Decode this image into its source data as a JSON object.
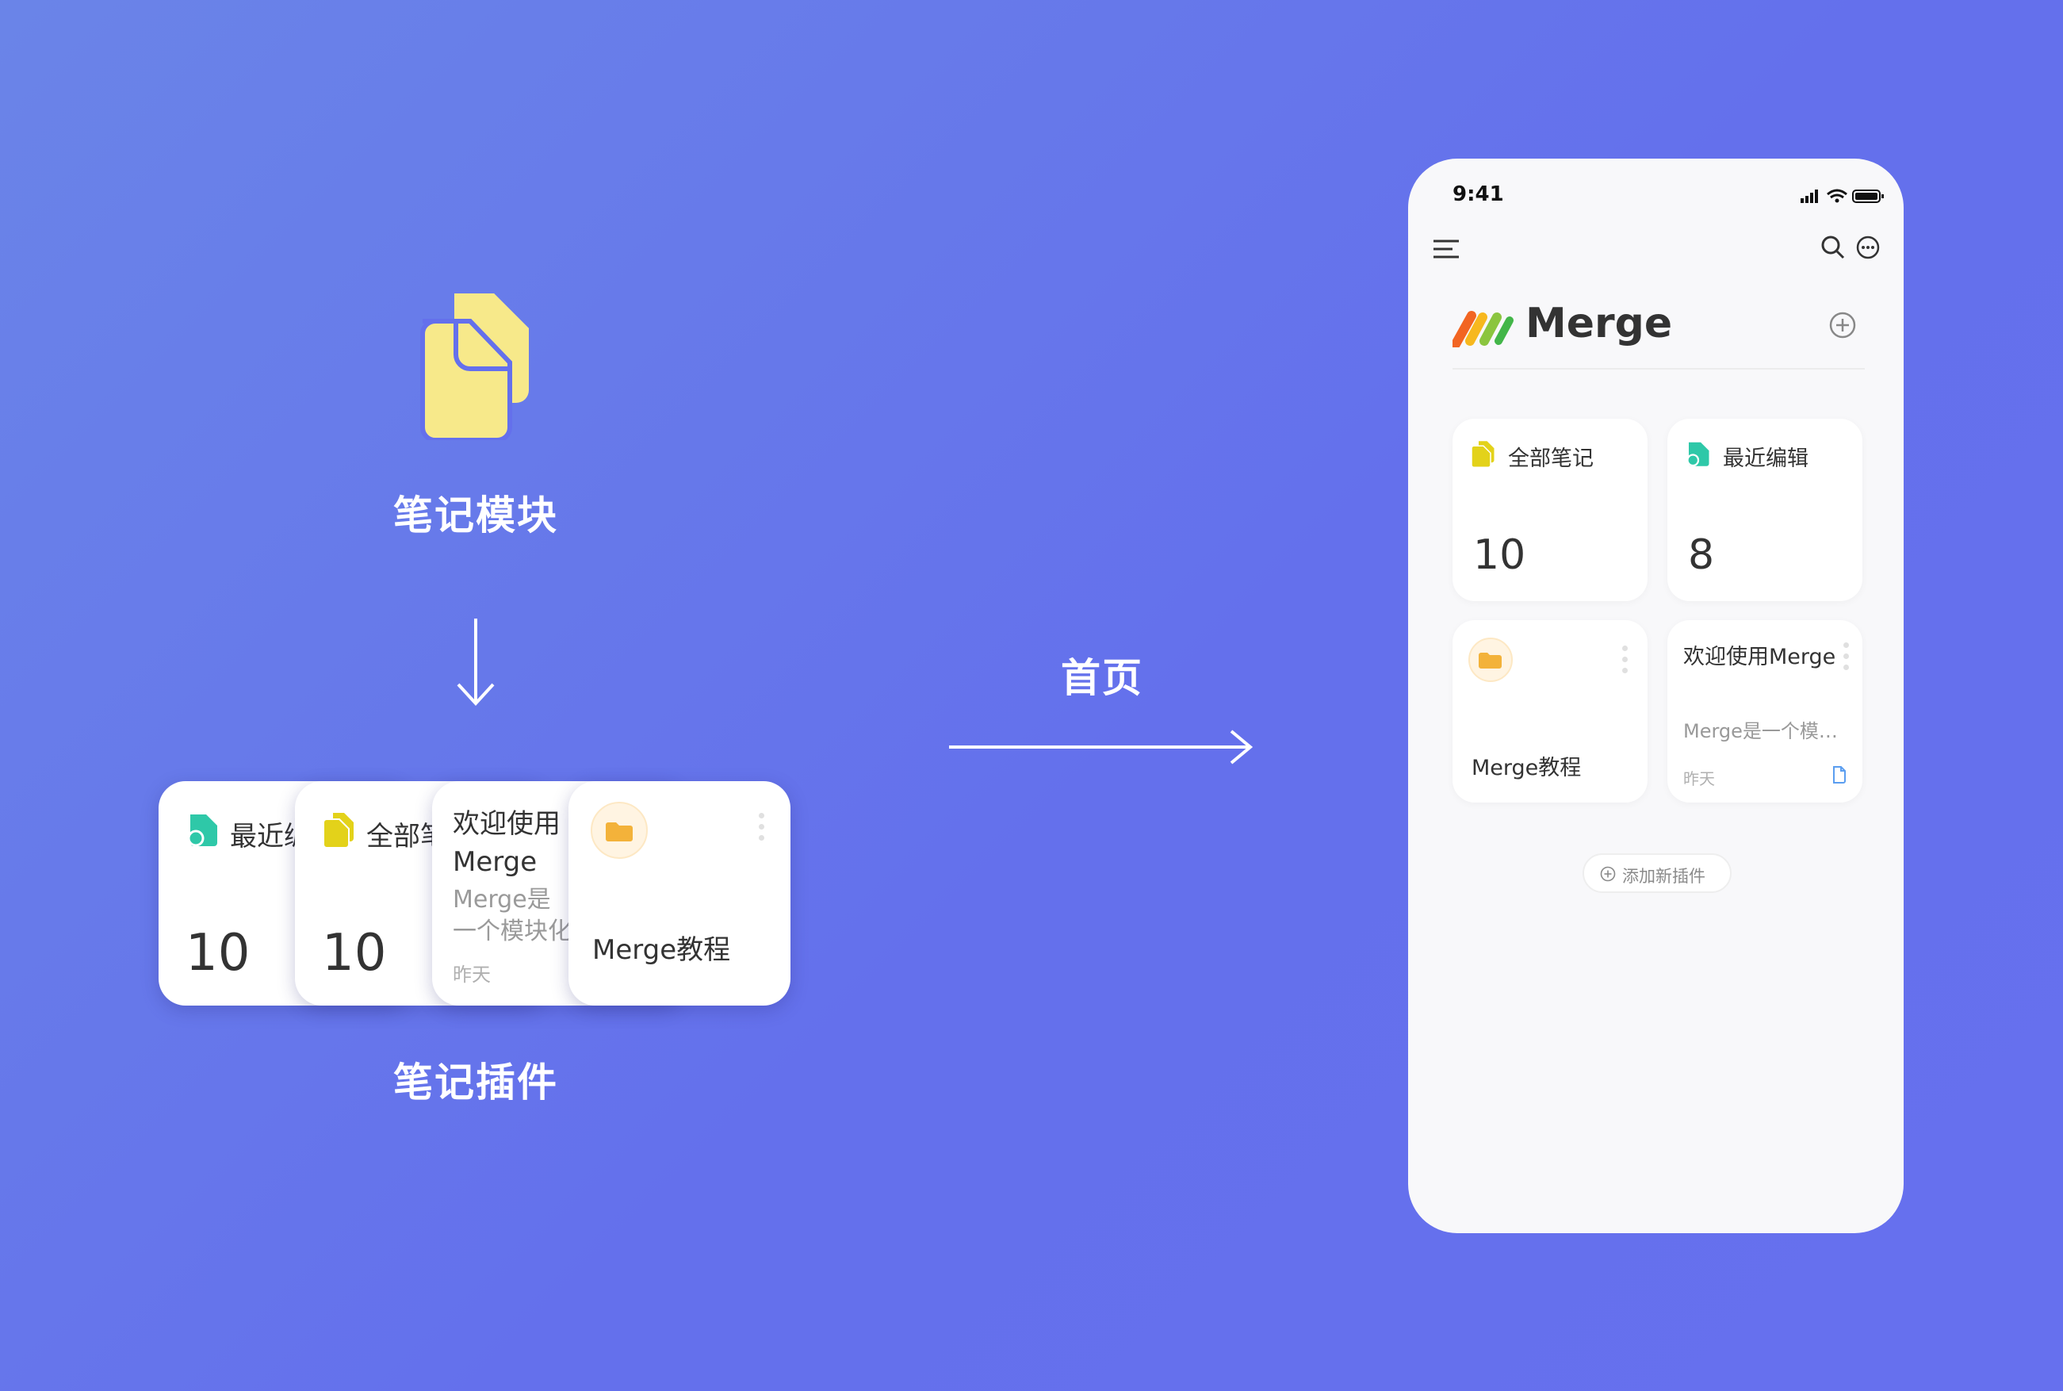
{
  "left": {
    "module_label": "笔记模块",
    "plugin_label": "笔记插件",
    "cards": {
      "recent": {
        "title": "最近编辑",
        "count": "10"
      },
      "all": {
        "title": "全部笔记",
        "count": "10"
      },
      "welcome": {
        "title": "欢迎使用Merge",
        "desc": "Merge是一个模块化效率工具",
        "date": "昨天"
      },
      "folder": {
        "name": "Merge教程"
      }
    }
  },
  "middle": {
    "home_label": "首页"
  },
  "phone": {
    "status_time": "9:41",
    "app_title": "Merge",
    "cards": {
      "all": {
        "title": "全部笔记",
        "count": "10"
      },
      "recent": {
        "title": "最近编辑",
        "count": "8"
      },
      "folder": {
        "name": "Merge教程"
      },
      "welcome": {
        "title": "欢迎使用Merge",
        "desc": "Merge是一个模…",
        "date": "昨天"
      }
    },
    "add_plugin_label": "添加新插件"
  },
  "colors": {
    "background": "#6470ec",
    "note_yellow": "#f7e98a",
    "doc_yellow": "#e3d21a",
    "doc_teal": "#2ec8a8",
    "folder_orange": "#f3b23a",
    "file_blue": "#5b9ef0"
  }
}
